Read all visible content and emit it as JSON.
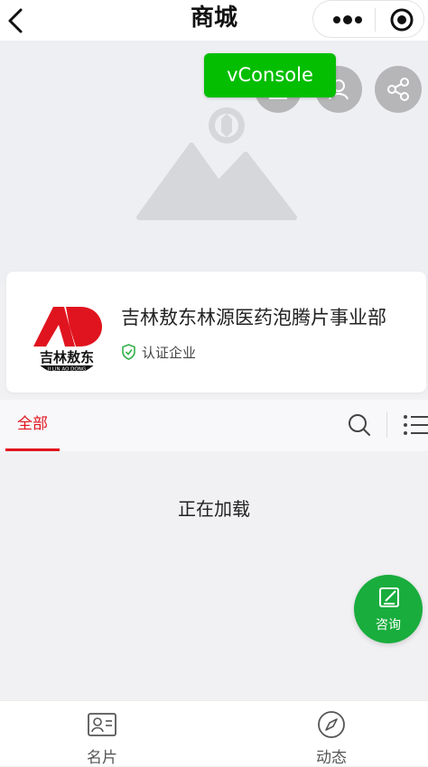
{
  "navbar": {
    "title": "商城",
    "back_icon": "chevron-left-icon",
    "more_icon": "more-dots-icon",
    "close_icon": "target-circle-icon"
  },
  "banner": {
    "placeholder_icon": "image-placeholder-icon",
    "vconsole_label": "vConsole",
    "action_icons": [
      "home-icon",
      "user-icon",
      "share-icon"
    ]
  },
  "store": {
    "name": "吉林敖东林源医药泡腾片事业部",
    "verified_label": "认证企业",
    "verified_color": "#33b24a",
    "logo_brand_text": "吉林敖东",
    "logo_sub_text": "JI LIN AO DONG",
    "logo_color": "#e0141e"
  },
  "tabs": {
    "all_label": "全部",
    "active_color": "#e0141e",
    "search_icon": "search-icon",
    "list_icon": "list-icon"
  },
  "content": {
    "loading_text": "正在加载"
  },
  "consult": {
    "label": "咨询",
    "icon": "edit-icon",
    "color": "#19ad3d"
  },
  "tabbar": {
    "items": [
      {
        "label": "名片",
        "icon": "business-card-icon"
      },
      {
        "label": "动态",
        "icon": "compass-icon"
      }
    ]
  }
}
